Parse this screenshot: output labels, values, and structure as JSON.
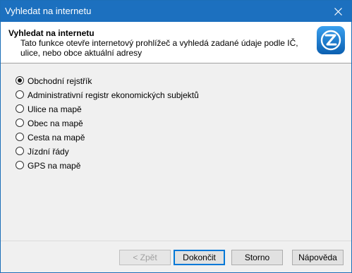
{
  "window": {
    "title": "Vyhledat na internetu"
  },
  "header": {
    "title": "Vyhledat na internetu",
    "description": "Tato funkce otevře internetový prohlížeč a vyhledá zadané údaje podle IČ, ulice, nebo obce aktuální adresy"
  },
  "options": {
    "selected_index": 0,
    "items": [
      {
        "label": "Obchodní rejstřík"
      },
      {
        "label": "Administrativní registr ekonomických subjektů"
      },
      {
        "label": "Ulice na mapě"
      },
      {
        "label": "Obec na mapě"
      },
      {
        "label": "Cesta na mapě"
      },
      {
        "label": "Jízdní řády"
      },
      {
        "label": "GPS na mapě"
      }
    ]
  },
  "buttons": {
    "back": "< Zpět",
    "finish": "Dokončit",
    "cancel": "Storno",
    "help": "Nápověda"
  },
  "colors": {
    "titlebar": "#1c70bf",
    "logo_blue": "#1a7fd4"
  },
  "icons": {
    "close": "close-icon",
    "logo": "app-logo-icon"
  }
}
